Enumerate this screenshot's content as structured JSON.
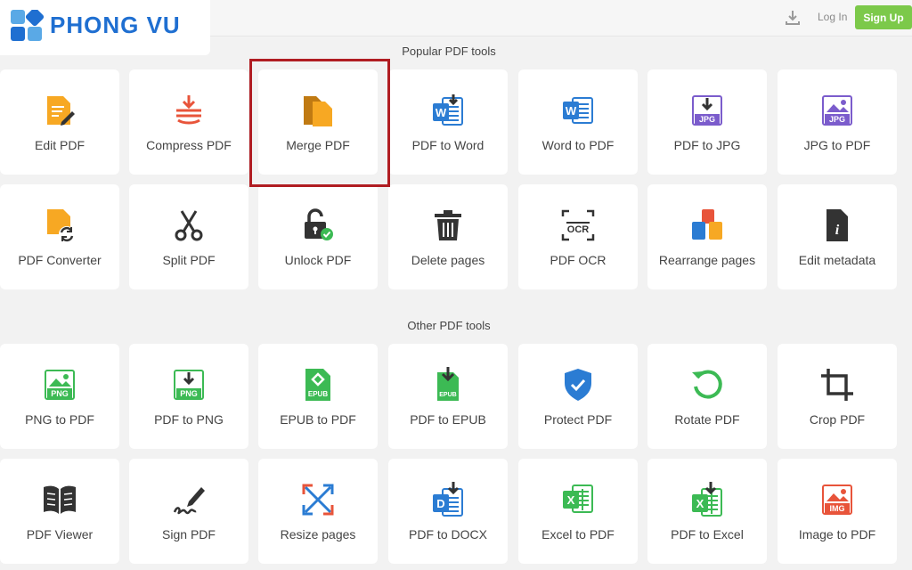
{
  "header": {
    "logo_text": "PHONG VU",
    "download_icon": "download-icon",
    "login_label": "Log In",
    "signup_label": "Sign Up"
  },
  "sections": {
    "popular_title": "Popular PDF tools",
    "other_title": "Other PDF tools"
  },
  "tools": {
    "edit_pdf": "Edit PDF",
    "compress_pdf": "Compress PDF",
    "merge_pdf": "Merge PDF",
    "pdf_to_word": "PDF to Word",
    "word_to_pdf": "Word to PDF",
    "pdf_to_jpg": "PDF to JPG",
    "jpg_to_pdf": "JPG to PDF",
    "pdf_converter": "PDF Converter",
    "split_pdf": "Split PDF",
    "unlock_pdf": "Unlock PDF",
    "delete_pages": "Delete pages",
    "pdf_ocr": "PDF OCR",
    "rearrange_pages": "Rearrange pages",
    "edit_metadata": "Edit metadata",
    "png_to_pdf": "PNG to PDF",
    "pdf_to_png": "PDF to PNG",
    "epub_to_pdf": "EPUB to PDF",
    "pdf_to_epub": "PDF to EPUB",
    "protect_pdf": "Protect PDF",
    "rotate_pdf": "Rotate PDF",
    "crop_pdf": "Crop PDF",
    "pdf_viewer": "PDF Viewer",
    "sign_pdf": "Sign PDF",
    "resize_pages": "Resize pages",
    "pdf_to_docx": "PDF to DOCX",
    "excel_to_pdf": "Excel to PDF",
    "pdf_to_excel": "PDF to Excel",
    "image_to_pdf": "Image to PDF"
  },
  "icon_badges": {
    "jpg": "JPG",
    "png": "PNG",
    "epub": "EPUB",
    "img": "IMG",
    "ocr": "OCR",
    "word": "W",
    "docx": "D",
    "excel": "X",
    "info": "i"
  },
  "highlighted_tool": "Merge PDF",
  "colors": {
    "brand_blue": "#1f6fd1",
    "signup_green": "#7cc94a",
    "highlight_red": "#b01d22",
    "page_bg": "#f2f2f2"
  }
}
